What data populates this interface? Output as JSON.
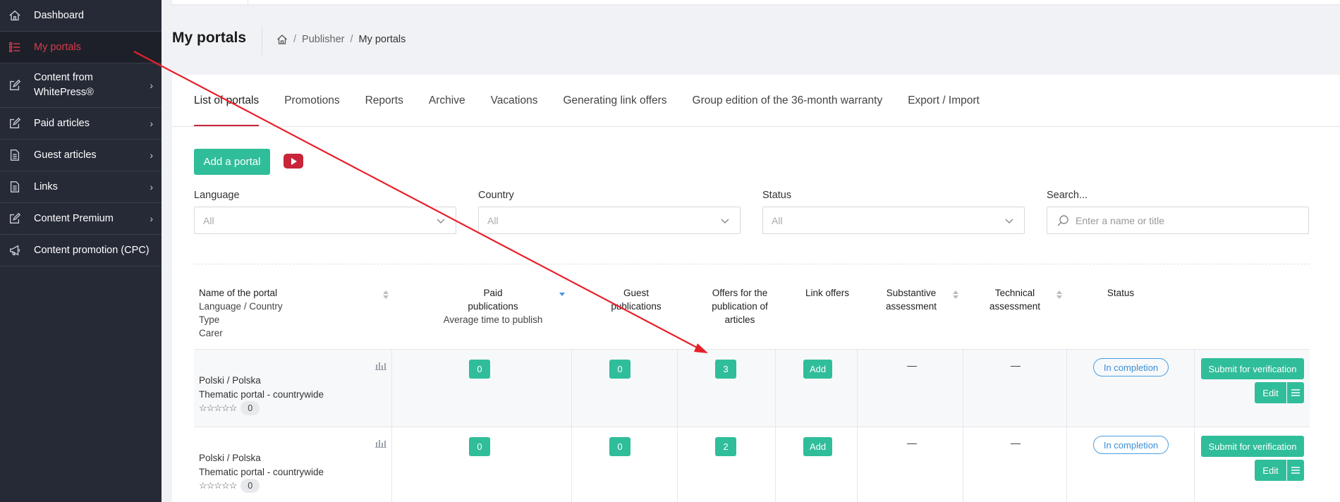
{
  "sidebar": {
    "items": [
      {
        "label": "Dashboard",
        "icon": "home-icon",
        "chevron": false,
        "active": false
      },
      {
        "label": "My portals",
        "icon": "list-icon",
        "chevron": false,
        "active": true
      },
      {
        "label": "Content from WhitePress®",
        "icon": "edit-icon",
        "chevron": true,
        "active": false
      },
      {
        "label": "Paid articles",
        "icon": "edit-icon",
        "chevron": true,
        "active": false
      },
      {
        "label": "Guest articles",
        "icon": "document-icon",
        "chevron": true,
        "active": false
      },
      {
        "label": "Links",
        "icon": "document-icon",
        "chevron": true,
        "active": false
      },
      {
        "label": "Content Premium",
        "icon": "edit-icon",
        "chevron": true,
        "active": false
      },
      {
        "label": "Content promotion (CPC)",
        "icon": "megaphone-icon",
        "chevron": false,
        "active": false
      }
    ],
    "chevron_glyph": "›"
  },
  "header": {
    "title": "My portals",
    "breadcrumb": {
      "separator": "/",
      "items": [
        "Publisher",
        "My portals"
      ]
    }
  },
  "tabs": [
    "List of portals",
    "Promotions",
    "Reports",
    "Archive",
    "Vacations",
    "Generating link offers",
    "Group edition of the 36-month warranty",
    "Export / Import"
  ],
  "toolbar": {
    "add_portal": "Add a portal"
  },
  "filters": {
    "language": {
      "label": "Language",
      "value": "All"
    },
    "country": {
      "label": "Country",
      "value": "All"
    },
    "status": {
      "label": "Status",
      "value": "All"
    },
    "search": {
      "label": "Search...",
      "placeholder": "Enter a name or title"
    }
  },
  "table": {
    "headers": {
      "name": [
        "Name of the portal",
        "Language / Country",
        "Type",
        "Carer"
      ],
      "paid": [
        "Paid",
        "publications",
        "Average time to publish"
      ],
      "guest": [
        "Guest",
        "publications"
      ],
      "offers": [
        "Offers for the",
        "publication of",
        "articles"
      ],
      "link": [
        "Link offers"
      ],
      "substantive": [
        "Substantive",
        "assessment"
      ],
      "technical": [
        "Technical",
        "assessment"
      ],
      "status": [
        "Status"
      ]
    },
    "rows": [
      {
        "lang_country": "Polski / Polska",
        "type": "Thematic portal - countrywide",
        "stars": "☆☆☆☆☆",
        "rating_count": "0",
        "paid": "0",
        "guest": "0",
        "offers": "3",
        "link": "Add",
        "substantive": "",
        "technical": "",
        "status": "In completion",
        "submit": "Submit for verification",
        "edit": "Edit"
      },
      {
        "lang_country": "Polski / Polska",
        "type": "Thematic portal - countrywide",
        "stars": "☆☆☆☆☆",
        "rating_count": "0",
        "paid": "0",
        "guest": "0",
        "offers": "2",
        "link": "Add",
        "substantive": "",
        "technical": "",
        "status": "In completion",
        "submit": "Submit for verification",
        "edit": "Edit"
      }
    ]
  },
  "colors": {
    "accent": "#c8253a",
    "button": "#30bd9a",
    "sidebar": "#262a36",
    "status": "#4a9fe0",
    "annotation": "#e8202a"
  }
}
